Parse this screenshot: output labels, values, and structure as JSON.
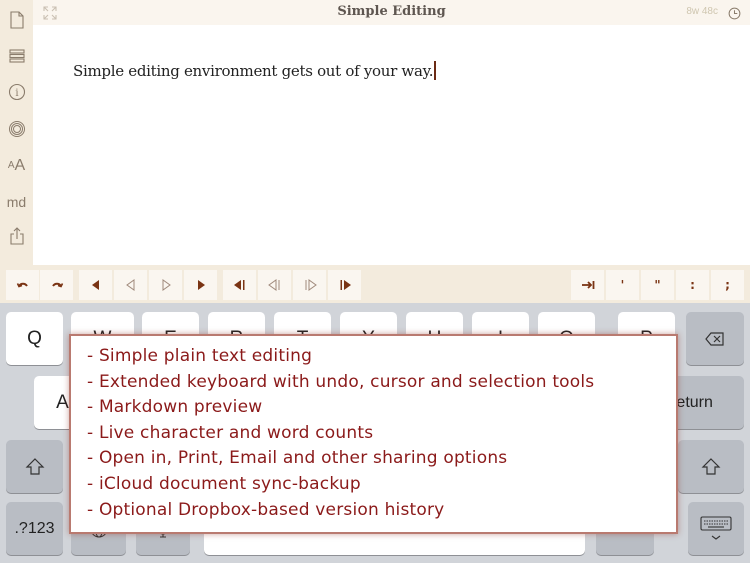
{
  "sidebar": {
    "items": [
      {
        "name": "new-document",
        "icon": "document-icon"
      },
      {
        "name": "document-list",
        "icon": "list-icon"
      },
      {
        "name": "info",
        "icon": "info-icon"
      },
      {
        "name": "focus",
        "icon": "target-icon"
      },
      {
        "name": "font-size",
        "icon": "font-size-icon",
        "label": "AA"
      },
      {
        "name": "markdown",
        "icon": "markdown-icon",
        "label": "md"
      },
      {
        "name": "share",
        "icon": "share-icon"
      }
    ]
  },
  "titlebar": {
    "title": "Simple Editing",
    "counts": "8w 48c",
    "expand_icon": "expand-icon",
    "history_icon": "clock-icon"
  },
  "editor": {
    "text": "Simple editing environment gets out of your way."
  },
  "toolbar": {
    "left_buttons": [
      {
        "name": "undo",
        "icon": "undo-icon"
      },
      {
        "name": "redo",
        "icon": "redo-icon"
      },
      {
        "name": "select-char-left",
        "icon": "filled-triangle-left-icon"
      },
      {
        "name": "cursor-left",
        "icon": "outline-triangle-left-icon"
      },
      {
        "name": "cursor-right",
        "icon": "outline-triangle-right-icon"
      },
      {
        "name": "select-char-right",
        "icon": "filled-triangle-right-icon"
      },
      {
        "name": "select-word-left",
        "icon": "filled-triangle-bar-left-icon"
      },
      {
        "name": "word-left",
        "icon": "outline-triangle-bar-left-icon"
      },
      {
        "name": "word-right",
        "icon": "outline-triangle-bar-right-icon"
      },
      {
        "name": "select-word-right",
        "icon": "filled-triangle-bar-right-icon"
      }
    ],
    "right_buttons": [
      {
        "name": "tab",
        "icon": "tab-icon",
        "label": "⇥"
      },
      {
        "name": "apostrophe",
        "label": "'"
      },
      {
        "name": "quote",
        "label": "\""
      },
      {
        "name": "colon",
        "label": ":"
      },
      {
        "name": "semicolon",
        "label": ";"
      }
    ]
  },
  "keyboard": {
    "row1": [
      "Q",
      "W",
      "E",
      "R",
      "T",
      "Y",
      "U",
      "I",
      "O",
      "P"
    ],
    "row2_first": "A",
    "return_label": "return",
    "numbers_label": ".?123",
    "backspace_icon": "backspace-icon",
    "shift_icon": "shift-icon",
    "globe_icon": "globe-icon",
    "dictation_icon": "microphone-icon",
    "dismiss_icon": "keyboard-dismiss-icon"
  },
  "features": {
    "items": [
      "- Simple plain text editing",
      "- Extended keyboard with undo, cursor and selection tools",
      "- Markdown preview",
      "- Live character and word counts",
      "- Open in, Print, Email and other sharing options",
      "- iCloud document sync-backup",
      "- Optional Dropbox-based version history"
    ]
  },
  "colors": {
    "accent": "#7a3414",
    "feature_text": "#8b1a1a",
    "sidebar_bg": "#f3ebdd",
    "keyboard_bg": "#d1d4d9"
  }
}
